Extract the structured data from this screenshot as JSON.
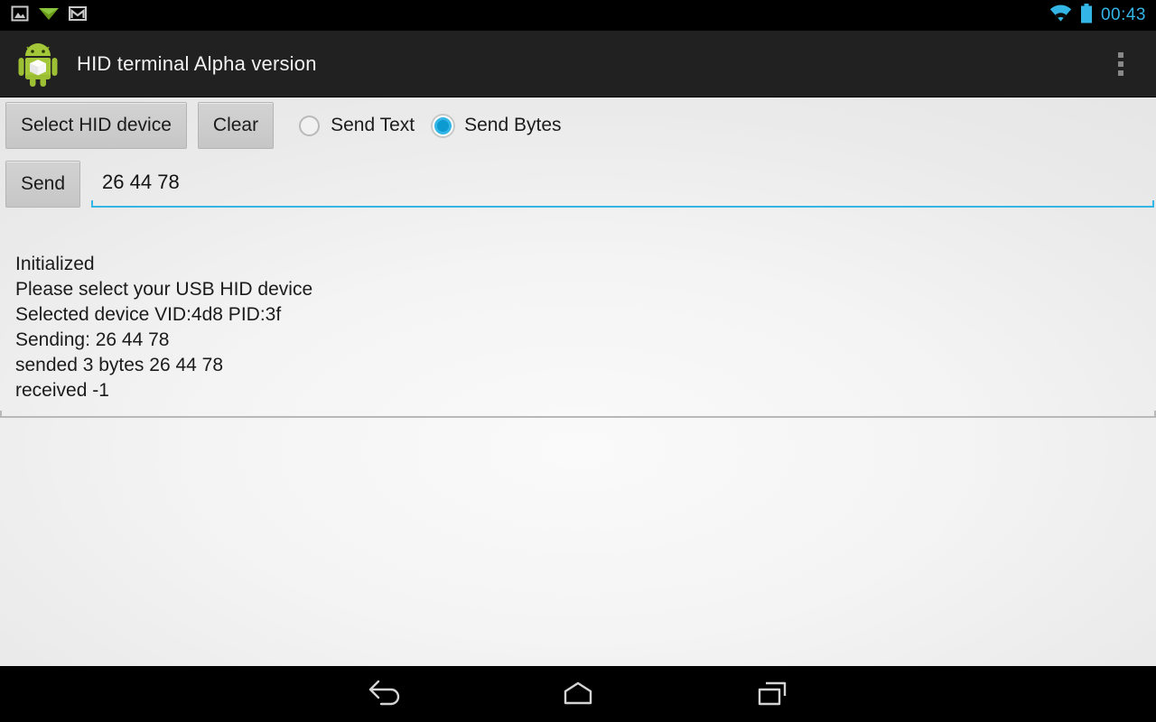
{
  "status_bar": {
    "icons": [
      "photo-icon",
      "download-triangle-icon",
      "gmail-icon"
    ],
    "wifi_icon": "wifi-icon",
    "battery_icon": "battery-icon",
    "clock": "00:43",
    "clock_color": "#33b5e5",
    "background": "#000000"
  },
  "action_bar": {
    "app_icon": "android-robot-icon",
    "title": "HID terminal Alpha version",
    "overflow_icon": "overflow-menu-icon",
    "background": "#212121"
  },
  "controls": {
    "select_device_label": "Select HID device",
    "clear_label": "Clear",
    "send_label": "Send",
    "radio_options": [
      {
        "label": "Send Text",
        "checked": false
      },
      {
        "label": "Send Bytes",
        "checked": true
      }
    ],
    "accent_color": "#33b5e5"
  },
  "send_field": {
    "value": "26 44 78",
    "placeholder": "",
    "underline_color": "#33b5e5"
  },
  "log": {
    "lines": [
      "Initialized",
      "Please select your USB HID device",
      "Selected device VID:4d8 PID:3f",
      "Sending: 26 44 78",
      "sended 3 bytes 26 44 78",
      "received -1"
    ],
    "text": "Initialized\nPlease select your USB HID device\nSelected device VID:4d8 PID:3f\nSending: 26 44 78\nsended 3 bytes 26 44 78\nreceived -1"
  },
  "nav_bar": {
    "back_icon": "back-arrow-icon",
    "home_icon": "home-icon",
    "recents_icon": "recents-icon",
    "background": "#000000"
  }
}
